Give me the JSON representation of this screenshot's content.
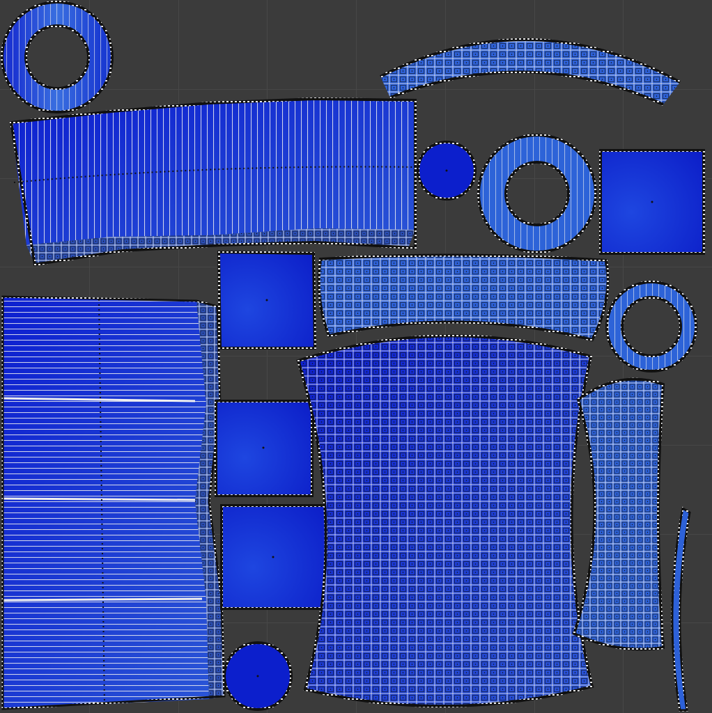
{
  "editor": {
    "background_color": "#3b3b3b",
    "grid_color": "#474747",
    "face_fill_dark": "#0d1fd0",
    "face_fill_light": "#3a72d8",
    "edge_color": "#f2f2f2",
    "seam_color": "#1a1a1a"
  }
}
